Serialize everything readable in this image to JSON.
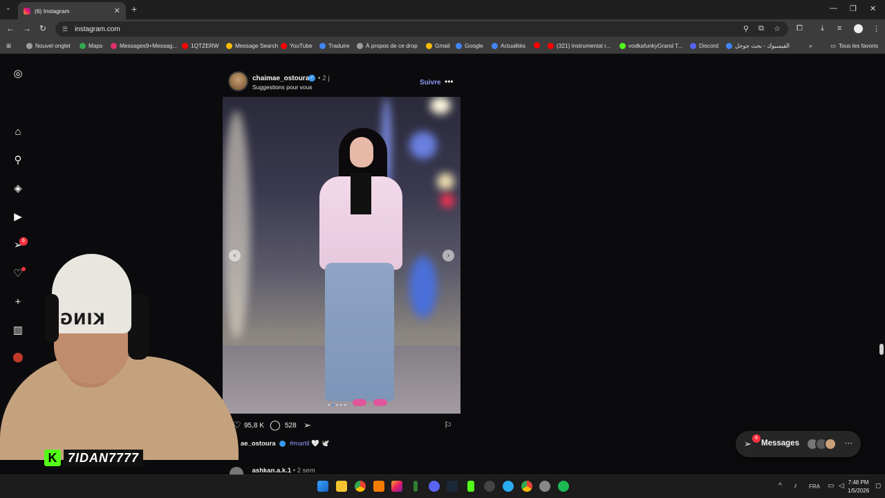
{
  "browser": {
    "tab_title": "(6) Instagram",
    "url": "instagram.com",
    "bookmarks": [
      {
        "label": "Nouvel onglet",
        "color": "#9e9e9e"
      },
      {
        "label": "Maps",
        "color": "#34a853"
      },
      {
        "label": "Messages9+Messag...",
        "color": "#e1306c"
      },
      {
        "label": "1QTZERW",
        "color": "#ff0000"
      },
      {
        "label": "Message Search",
        "color": "#fbbc04"
      },
      {
        "label": "YouTube",
        "color": "#ff0000"
      },
      {
        "label": "Traduire",
        "color": "#4285f4"
      },
      {
        "label": "À propos de ce drop",
        "color": "#9e9e9e"
      },
      {
        "label": "Gmail",
        "color": "#fbbc04"
      },
      {
        "label": "Google",
        "color": "#4285f4"
      },
      {
        "label": "Actualités",
        "color": "#4285f4"
      },
      {
        "label": "",
        "color": "#ff0000"
      },
      {
        "label": "(321) instrumental r...",
        "color": "#ff0000"
      },
      {
        "label": "vodkafunkyGrand T...",
        "color": "#53fc18"
      },
      {
        "label": "Discord",
        "color": "#5865f2"
      },
      {
        "label": "الفيسبوك - بحث جوجل",
        "color": "#4285f4"
      }
    ],
    "all_bookmarks_label": "Tous les favoris"
  },
  "sidebar": {
    "notification_badge": "6"
  },
  "post": {
    "username": "chaimae_ostoura",
    "time": "• 2 j",
    "subtitle": "Suggestions pour vous",
    "follow_label": "Suivre",
    "likes": "95,8 K",
    "comments": "528",
    "caption_user": "ae_ostoura",
    "caption_tag": "#martil",
    "caption_emoji": "🤍 🕊️"
  },
  "next_post": {
    "username": "ashkan.a.k.1",
    "time": "• 2 sem"
  },
  "messages": {
    "label": "Messages",
    "badge": "6"
  },
  "stream": {
    "name": "7IDAN7777",
    "beanie_text": "KING"
  },
  "taskbar": {
    "language": "FRA",
    "time": "7:48 PM",
    "date": "1/5/2026"
  },
  "colors": {
    "accent_link": "#8e9cf8",
    "verified": "#3897f0",
    "badge": "#ff3040",
    "kick_green": "#53fc18"
  }
}
